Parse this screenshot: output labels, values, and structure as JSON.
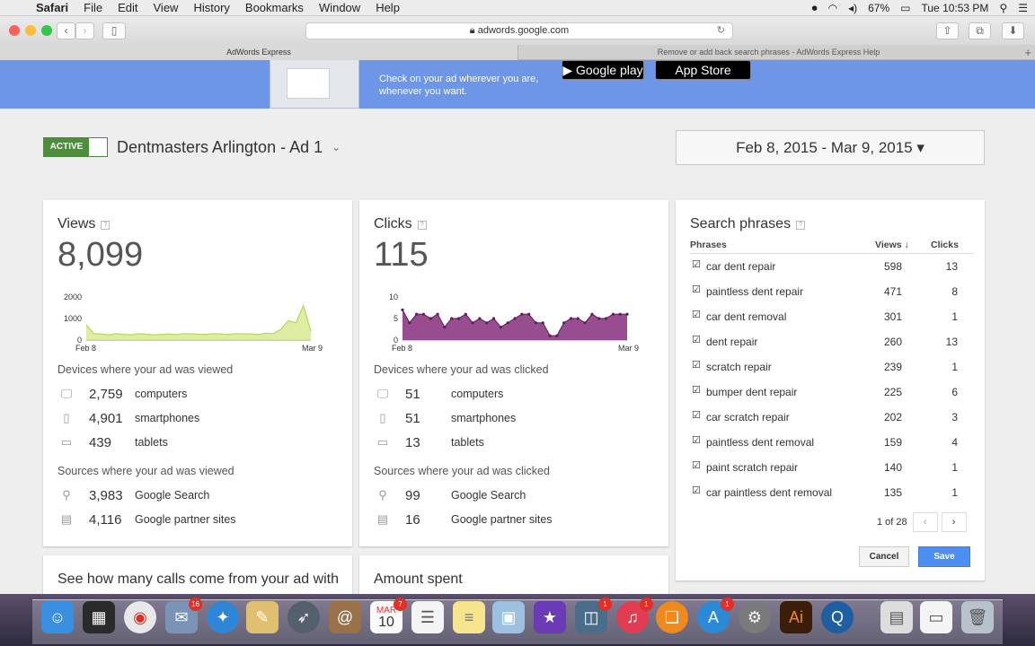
{
  "menubar": {
    "app": "Safari",
    "items": [
      "File",
      "Edit",
      "View",
      "History",
      "Bookmarks",
      "Window",
      "Help"
    ],
    "battery": "67%",
    "clock": "Tue 10:53 PM"
  },
  "browser": {
    "url": "adwords.google.com",
    "tabs": [
      "AdWords Express",
      "Remove or add back search phrases - AdWords Express Help"
    ]
  },
  "banner": {
    "text": "Check on your ad wherever you are, whenever you want.",
    "google_play": "Google play",
    "app_store": "App Store"
  },
  "ad": {
    "status": "ACTIVE",
    "title": "Dentmasters Arlington - Ad 1",
    "date_range": "Feb 8, 2015 - Mar 9, 2015 ▾"
  },
  "views": {
    "title": "Views",
    "help": "?",
    "total": "8,099",
    "devices_label": "Devices where your ad was viewed",
    "devices": [
      {
        "icon": "computer-icon",
        "value": "2,759",
        "label": "computers"
      },
      {
        "icon": "smartphone-icon",
        "value": "4,901",
        "label": "smartphones"
      },
      {
        "icon": "tablet-icon",
        "value": "439",
        "label": "tablets"
      }
    ],
    "sources_label": "Sources where your ad was viewed",
    "sources": [
      {
        "icon": "search-icon",
        "value": "3,983",
        "label": "Google Search"
      },
      {
        "icon": "partner-sites-icon",
        "value": "4,116",
        "label": "Google partner sites"
      }
    ]
  },
  "clicks": {
    "title": "Clicks",
    "help": "?",
    "total": "115",
    "devices_label": "Devices where your ad was clicked",
    "devices": [
      {
        "icon": "computer-icon",
        "value": "51",
        "label": "computers"
      },
      {
        "icon": "smartphone-icon",
        "value": "51",
        "label": "smartphones"
      },
      {
        "icon": "tablet-icon",
        "value": "13",
        "label": "tablets"
      }
    ],
    "sources_label": "Sources where your ad was clicked",
    "sources": [
      {
        "icon": "search-icon",
        "value": "99",
        "label": "Google Search"
      },
      {
        "icon": "partner-sites-icon",
        "value": "16",
        "label": "Google partner sites"
      }
    ]
  },
  "phrases": {
    "title": "Search phrases",
    "help": "?",
    "col_phrase": "Phrases",
    "col_views": "Views ↓",
    "col_clicks": "Clicks",
    "rows": [
      {
        "phrase": "car dent repair",
        "views": "598",
        "clicks": "13"
      },
      {
        "phrase": "paintless dent repair",
        "views": "471",
        "clicks": "8"
      },
      {
        "phrase": "car dent removal",
        "views": "301",
        "clicks": "1"
      },
      {
        "phrase": "dent repair",
        "views": "260",
        "clicks": "13"
      },
      {
        "phrase": "scratch repair",
        "views": "239",
        "clicks": "1"
      },
      {
        "phrase": "bumper dent repair",
        "views": "225",
        "clicks": "6"
      },
      {
        "phrase": "car scratch repair",
        "views": "202",
        "clicks": "3"
      },
      {
        "phrase": "paintless dent removal",
        "views": "159",
        "clicks": "4"
      },
      {
        "phrase": "paint scratch repair",
        "views": "140",
        "clicks": "1"
      },
      {
        "phrase": "car paintless dent removal",
        "views": "135",
        "clicks": "1"
      }
    ],
    "pager": "1 of 28",
    "cancel": "Cancel",
    "save": "Save"
  },
  "bottom_cards": [
    "See how many calls come from your ad with",
    "Amount spent"
  ],
  "chart_data": [
    {
      "type": "area",
      "title": "Views",
      "x": [
        "Feb 8",
        "Mar 9"
      ],
      "ylim": [
        0,
        2000
      ],
      "yticks": [
        "2000",
        "1000",
        "0"
      ],
      "xticks": [
        "Feb 8",
        "Mar 9"
      ],
      "color": "#d4e98a",
      "values": [
        700,
        300,
        280,
        240,
        300,
        260,
        240,
        300,
        270,
        240,
        260,
        280,
        250,
        300,
        290,
        270,
        260,
        300,
        280,
        260,
        300,
        290,
        280,
        260,
        320,
        300,
        500,
        900,
        800,
        1600,
        400
      ]
    },
    {
      "type": "area",
      "title": "Clicks",
      "x": [
        "Feb 8",
        "Mar 9"
      ],
      "ylim": [
        0,
        10
      ],
      "yticks": [
        "10",
        "5",
        "0"
      ],
      "xticks": [
        "Feb 8",
        "Mar 9"
      ],
      "color": "#8d3a85",
      "values": [
        7,
        4,
        6,
        6,
        5,
        6,
        3,
        5,
        5,
        6,
        4,
        5,
        4,
        5,
        3,
        4,
        5,
        6,
        6,
        4,
        4,
        1,
        1,
        4,
        5,
        5,
        4,
        6,
        5,
        5,
        6,
        6,
        6
      ]
    }
  ],
  "dock": {
    "calendar_day": "10",
    "calendar_month": "MAR",
    "badges": [
      "16",
      "7",
      "1",
      "1",
      "1"
    ]
  }
}
